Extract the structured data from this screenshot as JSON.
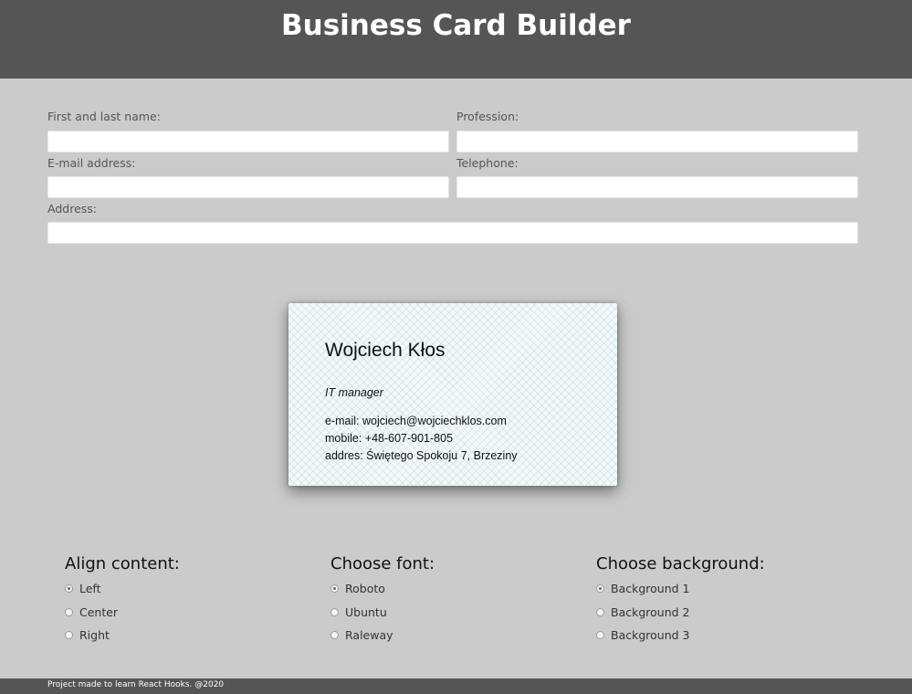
{
  "header": {
    "title": "Business Card Builder"
  },
  "form": {
    "name_label": "First and last name:",
    "name_value": "",
    "profession_label": "Profession:",
    "profession_value": "",
    "email_label": "E-mail address:",
    "email_value": "",
    "phone_label": "Telephone:",
    "phone_value": "",
    "address_label": "Address:",
    "address_value": ""
  },
  "card": {
    "name": "Wojciech Kłos",
    "profession": "IT manager",
    "email_line": "e-mail: wojciech@wojciechklos.com",
    "mobile_line": "mobile: +48-607-901-805",
    "address_line": "addres: Świętego Spokoju 7, Brzeziny"
  },
  "options": {
    "align": {
      "title": "Align content:",
      "items": [
        "Left",
        "Center",
        "Right"
      ],
      "selected": "Left"
    },
    "font": {
      "title": "Choose font:",
      "items": [
        "Roboto",
        "Ubuntu",
        "Raleway"
      ],
      "selected": "Roboto"
    },
    "background": {
      "title": "Choose background:",
      "items": [
        "Background 1",
        "Background 2",
        "Background 3"
      ],
      "selected": "Background 1"
    }
  },
  "footer": {
    "text": "Project made to learn React Hooks. @2020"
  },
  "colors": {
    "header_bg": "#555555",
    "page_bg": "#cbcbcb",
    "footer_bg": "#555555"
  }
}
